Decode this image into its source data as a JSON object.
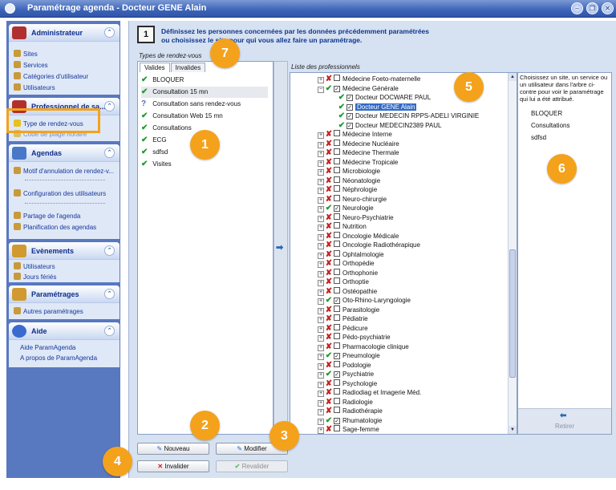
{
  "window": {
    "title": "Paramétrage agenda - Docteur GENE Alain",
    "controls": [
      "minimize",
      "restore",
      "close"
    ]
  },
  "sidebar": {
    "groups": [
      {
        "title": "Administrateur",
        "items": [
          "Sites",
          "Services",
          "Catégories d'utilisateur",
          "Utilisateurs"
        ]
      },
      {
        "title": "Professionnel de sa...",
        "items": [
          "Type de rendez-vous",
          "Code de plage horaire"
        ]
      },
      {
        "title": "Agendas",
        "items": [
          "Motif d'annulation de rendez-v...",
          "Configuration des utilisateurs",
          "Partage de l'agenda",
          "Planification des agendas"
        ]
      },
      {
        "title": "Evènements",
        "items": [
          "Utilisateurs",
          "Jours fériés"
        ]
      },
      {
        "title": "Paramétrages",
        "items": [
          "Autres paramétrages"
        ]
      },
      {
        "title": "Aide",
        "items": [
          "Aide ParamAgenda",
          "A propos de ParamAgenda"
        ]
      }
    ]
  },
  "step": {
    "number": "1",
    "line1": "Définissez les personnes concernées par les données précédemment paramétrées",
    "line2": "ou choisissez le site pour qui vous allez faire un paramétrage."
  },
  "types_panel": {
    "title": "Types de rendez-vous",
    "tabs": [
      "Valides",
      "Invalides"
    ],
    "items": [
      {
        "label": "BLOQUER",
        "mark": "check"
      },
      {
        "label": "Consultation 15 mn",
        "mark": "check"
      },
      {
        "label": "Consultation sans rendez-vous",
        "mark": "question"
      },
      {
        "label": "Consultation Web 15 mn",
        "mark": "check"
      },
      {
        "label": "Consultations",
        "mark": "check"
      },
      {
        "label": "ECG",
        "mark": "check"
      },
      {
        "label": "sdfsd",
        "mark": "check"
      },
      {
        "label": "Visites",
        "mark": "check"
      }
    ]
  },
  "pros_panel": {
    "title": "Liste des professionnels",
    "rows": [
      {
        "label": "Médecine Foeto-maternelle",
        "state": "x",
        "checked": false,
        "level": 0
      },
      {
        "label": "Médecine Générale",
        "state": "v",
        "checked": true,
        "level": 0,
        "expanded": true
      },
      {
        "label": "Docteur DOCWARE PAUL",
        "state": "v",
        "checked": true,
        "level": 1
      },
      {
        "label": "Docteur GENE Alain",
        "state": "v",
        "checked": true,
        "level": 1,
        "selected": true
      },
      {
        "label": "Docteur MEDECIN RPPS-ADELI VIRGINIE",
        "state": "v",
        "checked": true,
        "level": 1
      },
      {
        "label": "Docteur MEDECIN2389 PAUL",
        "state": "v",
        "checked": true,
        "level": 1
      },
      {
        "label": "Médecine Interne",
        "state": "x",
        "checked": false,
        "level": 0
      },
      {
        "label": "Médecine Nucléaire",
        "state": "x",
        "checked": false,
        "level": 0
      },
      {
        "label": "Médecine Thermale",
        "state": "x",
        "checked": false,
        "level": 0
      },
      {
        "label": "Médecine Tropicale",
        "state": "x",
        "checked": false,
        "level": 0
      },
      {
        "label": "Microbiologie",
        "state": "x",
        "checked": false,
        "level": 0
      },
      {
        "label": "Néonatologie",
        "state": "x",
        "checked": false,
        "level": 0
      },
      {
        "label": "Néphrologie",
        "state": "x",
        "checked": false,
        "level": 0
      },
      {
        "label": "Neuro-chirurgie",
        "state": "x",
        "checked": false,
        "level": 0
      },
      {
        "label": "Neurologie",
        "state": "v",
        "checked": true,
        "level": 0
      },
      {
        "label": "Neuro-Psychiatrie",
        "state": "x",
        "checked": false,
        "level": 0
      },
      {
        "label": "Nutrition",
        "state": "x",
        "checked": false,
        "level": 0
      },
      {
        "label": "Oncologie Médicale",
        "state": "x",
        "checked": false,
        "level": 0
      },
      {
        "label": "Oncologie Radiothérapique",
        "state": "x",
        "checked": false,
        "level": 0
      },
      {
        "label": "Ophtalmologie",
        "state": "x",
        "checked": false,
        "level": 0
      },
      {
        "label": "Orthopédie",
        "state": "x",
        "checked": false,
        "level": 0
      },
      {
        "label": "Orthophonie",
        "state": "x",
        "checked": false,
        "level": 0
      },
      {
        "label": "Orthoptie",
        "state": "x",
        "checked": false,
        "level": 0
      },
      {
        "label": "Ostéopathie",
        "state": "x",
        "checked": false,
        "level": 0
      },
      {
        "label": "Oto-Rhino-Laryngologie",
        "state": "v",
        "checked": true,
        "level": 0
      },
      {
        "label": "Parasitologie",
        "state": "x",
        "checked": false,
        "level": 0
      },
      {
        "label": "Pédiatrie",
        "state": "x",
        "checked": false,
        "level": 0
      },
      {
        "label": "Pédicure",
        "state": "x",
        "checked": false,
        "level": 0
      },
      {
        "label": "Pédo-psychiatrie",
        "state": "x",
        "checked": false,
        "level": 0
      },
      {
        "label": "Pharmacologie clinique",
        "state": "x",
        "checked": false,
        "level": 0
      },
      {
        "label": "Pneumologie",
        "state": "v",
        "checked": true,
        "level": 0
      },
      {
        "label": "Podologie",
        "state": "x",
        "checked": false,
        "level": 0
      },
      {
        "label": "Psychiatrie",
        "state": "v",
        "checked": true,
        "level": 0
      },
      {
        "label": "Psychologie",
        "state": "x",
        "checked": false,
        "level": 0
      },
      {
        "label": "Radiodiag et Imagerie Méd.",
        "state": "x",
        "checked": false,
        "level": 0
      },
      {
        "label": "Radiologie",
        "state": "x",
        "checked": false,
        "level": 0
      },
      {
        "label": "Radiothérapie",
        "state": "x",
        "checked": false,
        "level": 0
      },
      {
        "label": "Rhumatologie",
        "state": "v",
        "checked": true,
        "level": 0
      },
      {
        "label": "Sage-femme",
        "state": "x",
        "checked": false,
        "level": 0
      }
    ]
  },
  "assigned_panel": {
    "hint": "Choisissez un site, un service ou un utilisateur dans l'arbre ci-contre pour voir le paramétrage qui lui a été attribué.",
    "items": [
      "BLOQUER",
      "Consultations",
      "sdfsd"
    ],
    "remove_label": "Retirer"
  },
  "buttons": {
    "new": "Nouveau",
    "edit": "Modifier",
    "invalidate": "Invalider",
    "revalidate": "Revalider"
  },
  "callouts": [
    "1",
    "2",
    "3",
    "4",
    "5",
    "6",
    "7"
  ],
  "colors": {
    "accent": "#f4a21c",
    "sidebar": "#5878c0",
    "selection": "#316ac5"
  }
}
